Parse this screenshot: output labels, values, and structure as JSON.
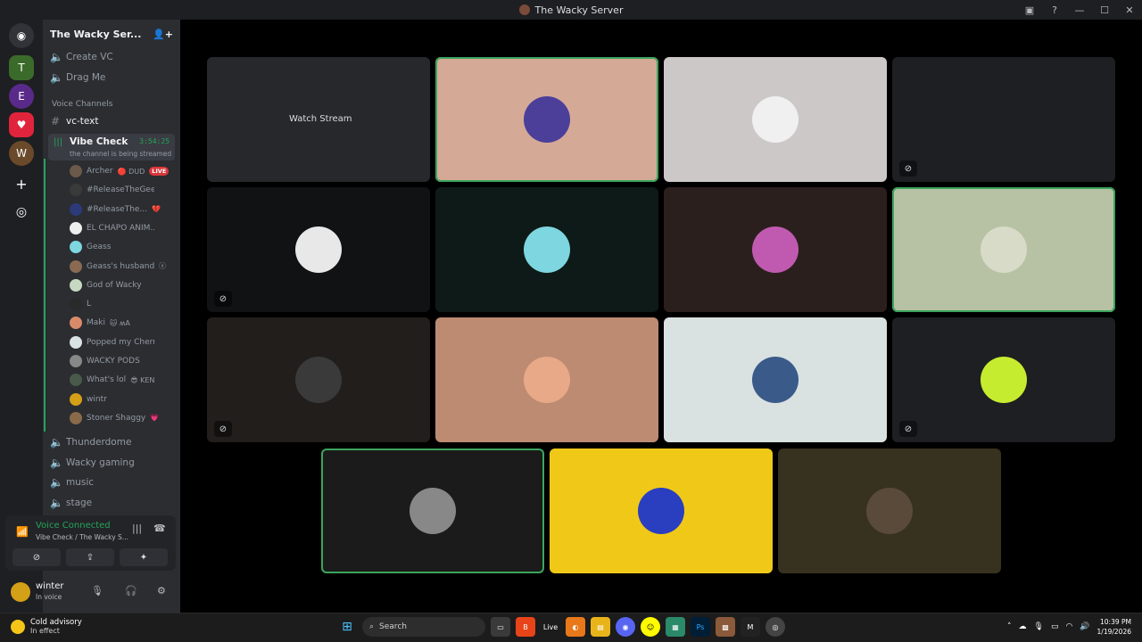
{
  "window": {
    "title": "The Wacky Server",
    "controls": [
      "—",
      "☐",
      "✕"
    ]
  },
  "server": {
    "name": "The Wacky Ser...",
    "menu_icon": "chevron-down-icon"
  },
  "channels_top": [
    {
      "label": "Create VC",
      "icon": "plus-icon"
    },
    {
      "label": "Drag Me",
      "icon": "speaker-icon"
    }
  ],
  "category": "Voice Channels",
  "text_channel": "vc-text",
  "active_voice": {
    "name": "Vibe Check",
    "timer": "3:54:25",
    "subtitle": "the channel is being streamed"
  },
  "members": [
    {
      "name": "Archer",
      "extra": "🔴 DUD",
      "badge": "LIVE",
      "color": "#6b5a4a"
    },
    {
      "name": "#ReleaseTheGeekFiles",
      "extra": "",
      "color": "#3a3a3a"
    },
    {
      "name": "#ReleaseThe...",
      "extra": "💔",
      "color": "#2c3a7a"
    },
    {
      "name": "EL CHAPO ANIM...",
      "extra": "",
      "color": "#eeeeee"
    },
    {
      "name": "Geass",
      "extra": "",
      "color": "#7dd6e0"
    },
    {
      "name": "Geass's husband",
      "extra": "ⓧ",
      "color": "#8a6a52"
    },
    {
      "name": "God of Wacky",
      "extra": "",
      "color": "#c7d8c0"
    },
    {
      "name": "L",
      "extra": "",
      "color": "#2a2a2a"
    },
    {
      "name": "Maki",
      "extra": "🐱 ʍA",
      "color": "#d98a6a"
    },
    {
      "name": "Popped my Cherry",
      "extra": "",
      "color": "#d9e2e4"
    },
    {
      "name": "WACKY PODS",
      "extra": "",
      "color": "#888888"
    },
    {
      "name": "What's lol",
      "extra": "😎 KEN",
      "color": "#4a5a4a"
    },
    {
      "name": "wintr",
      "extra": "",
      "color": "#d4a017"
    },
    {
      "name": "Stoner Shaggy",
      "extra": "💗",
      "color": "#8a6a4a"
    }
  ],
  "other_voice": [
    "Thunderdome",
    "Wacky gaming",
    "music",
    "stage"
  ],
  "voice_panel": {
    "status": "Voice Connected",
    "location": "Vibe Check / The Wacky S..."
  },
  "user": {
    "name": "winter",
    "status": "In voice"
  },
  "stream_tile": {
    "label": "Watch Stream"
  },
  "tiles": [
    {
      "bg": "#d4a996",
      "av": "#4b3f9a",
      "speaking": true,
      "muted": false
    },
    {
      "bg": "#ccc8c8",
      "av": "#f0f0f0",
      "speaking": false,
      "muted": false
    },
    {
      "bg": "#1e1f22",
      "av": "#1e1f22",
      "speaking": false,
      "muted": true
    },
    {
      "bg": "#111213",
      "av": "#e8e8e8",
      "speaking": false,
      "muted": true
    },
    {
      "bg": "#0e1a17",
      "av": "#7dd6e0",
      "speaking": false,
      "muted": false
    },
    {
      "bg": "#2b1f1d",
      "av": "#c05ab0",
      "speaking": false,
      "muted": false
    },
    {
      "bg": "#b7c2a4",
      "av": "#d8dbc8",
      "speaking": true,
      "muted": false
    },
    {
      "bg": "#221e1b",
      "av": "#3a3a3a",
      "speaking": false,
      "muted": true
    },
    {
      "bg": "#bd8b72",
      "av": "#e8a988",
      "speaking": false,
      "muted": false
    },
    {
      "bg": "#d9e2e0",
      "av": "#3a5a8a",
      "speaking": false,
      "muted": false
    },
    {
      "bg": "#1e1f22",
      "av": "#c6ec30",
      "speaking": false,
      "muted": true
    },
    {
      "bg": "#1b1b1b",
      "av": "#888888",
      "speaking": true,
      "muted": false
    },
    {
      "bg": "#f0c918",
      "av": "#2a3ec0",
      "speaking": false,
      "muted": false
    },
    {
      "bg": "#37321f",
      "av": "#5a4a3a",
      "speaking": false,
      "muted": false
    }
  ],
  "taskbar": {
    "weather_title": "Cold advisory",
    "weather_sub": "In effect",
    "search_placeholder": "Search",
    "time": "10:39 PM",
    "date": "1/19/2026",
    "apps": [
      "Windows",
      "Search",
      "Files",
      "Brave",
      "Live",
      "Firefox",
      "Folder",
      "Discord",
      "Snapchat",
      "Photos",
      "Ps",
      "Gallery",
      "M",
      "Chrome"
    ]
  }
}
